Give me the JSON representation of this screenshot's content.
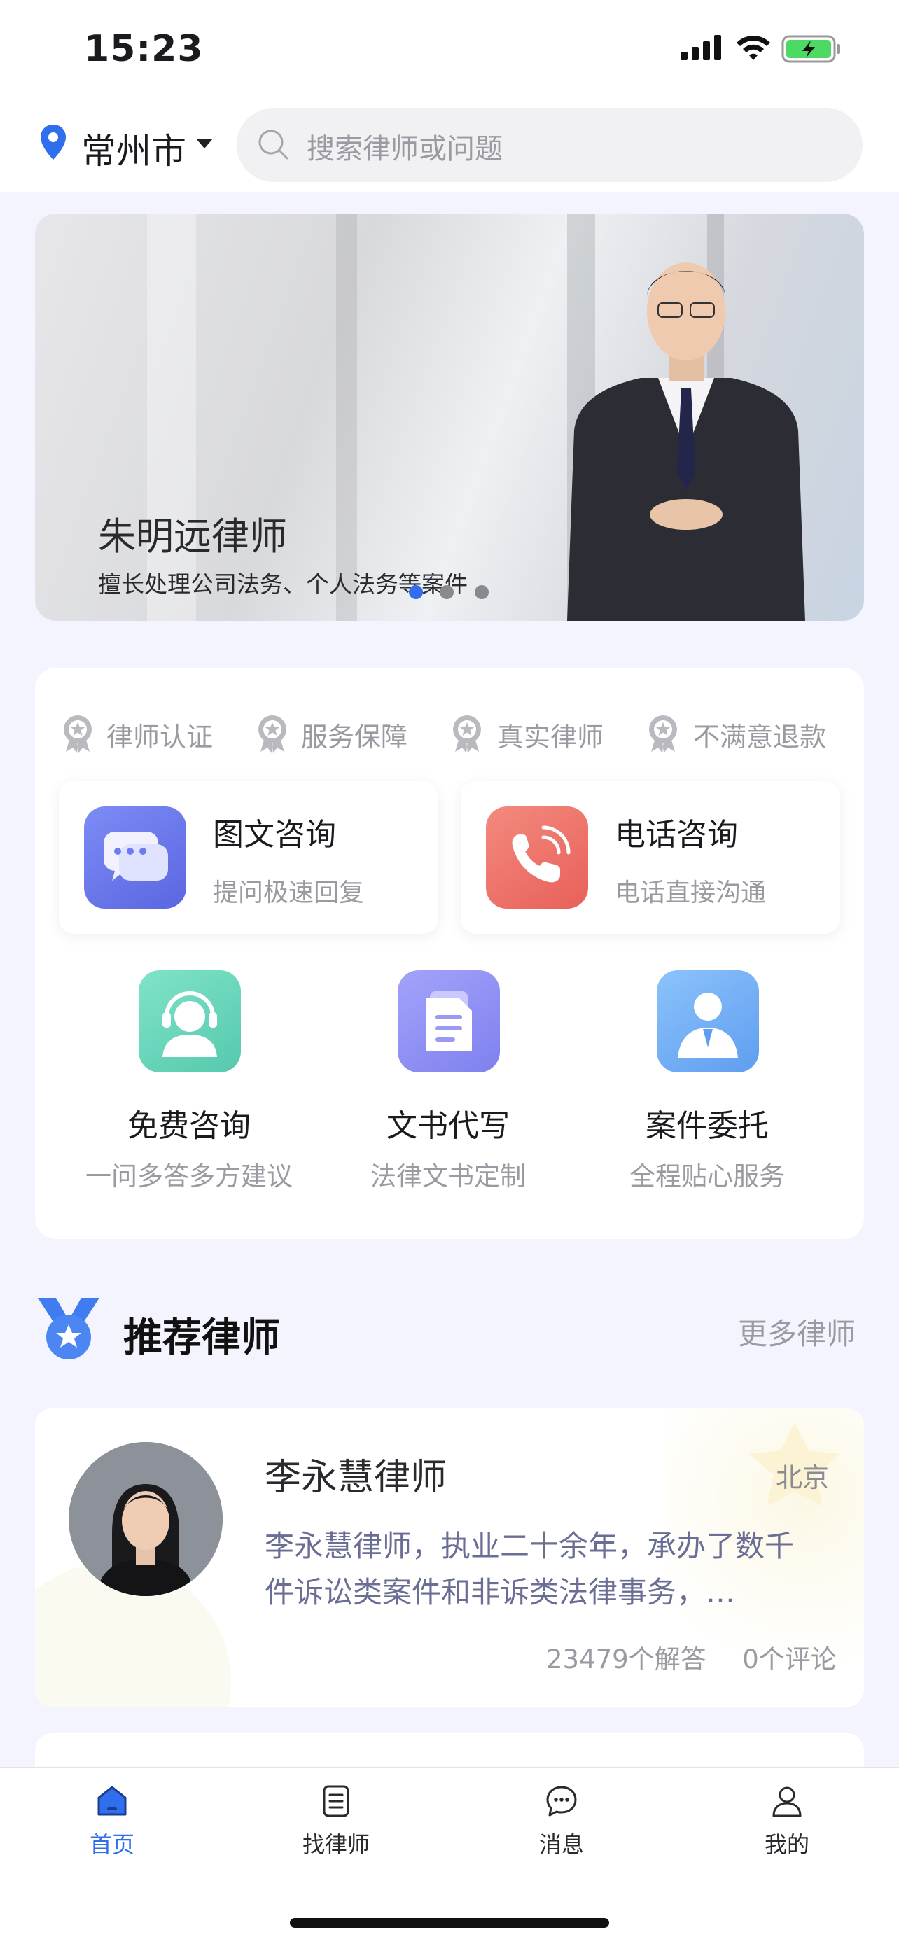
{
  "status": {
    "time": "15:23"
  },
  "header": {
    "city": "常州市",
    "search_placeholder": "搜索律师或问题"
  },
  "banner": {
    "name": "朱明远律师",
    "desc": "擅长处理公司法务、个人法务等案件"
  },
  "badges": [
    {
      "label": "律师认证",
      "icon": "award-icon"
    },
    {
      "label": "服务保障",
      "icon": "award-icon"
    },
    {
      "label": "真实律师",
      "icon": "award-icon"
    },
    {
      "label": "不满意退款",
      "icon": "award-icon"
    }
  ],
  "tiles": [
    {
      "title": "图文咨询",
      "sub": "提问极速回复",
      "icon": "chat-bubbles-icon",
      "color": "#6c7bf0"
    },
    {
      "title": "电话咨询",
      "sub": "电话直接沟通",
      "icon": "phone-icon",
      "color": "#ef7468"
    }
  ],
  "services": [
    {
      "title": "免费咨询",
      "sub": "一问多答多方建议",
      "icon": "headset-icon",
      "color": "#6fd8bf"
    },
    {
      "title": "文书代写",
      "sub": "法律文书定制",
      "icon": "document-icon",
      "color": "#8f8ff5"
    },
    {
      "title": "案件委托",
      "sub": "全程贴心服务",
      "icon": "person-suit-icon",
      "color": "#74b0f5"
    }
  ],
  "recommend": {
    "title": "推荐律师",
    "more": "更多律师"
  },
  "lawyers": [
    {
      "name": "李永慧律师",
      "city": "北京",
      "desc": "李永慧律师，执业二十余年，承办了数千件诉讼类案件和非诉类法律事务，…",
      "answers": "23479个解答",
      "comments": "0个评论"
    }
  ],
  "tabbar": [
    {
      "label": "首页",
      "icon": "home-icon",
      "active": true
    },
    {
      "label": "找律师",
      "icon": "list-icon",
      "active": false
    },
    {
      "label": "消息",
      "icon": "message-icon",
      "active": false
    },
    {
      "label": "我的",
      "icon": "user-icon",
      "active": false
    }
  ],
  "colors": {
    "accent": "#2f6fed",
    "text": "#1b1b1f",
    "muted": "#9a9aa2"
  }
}
